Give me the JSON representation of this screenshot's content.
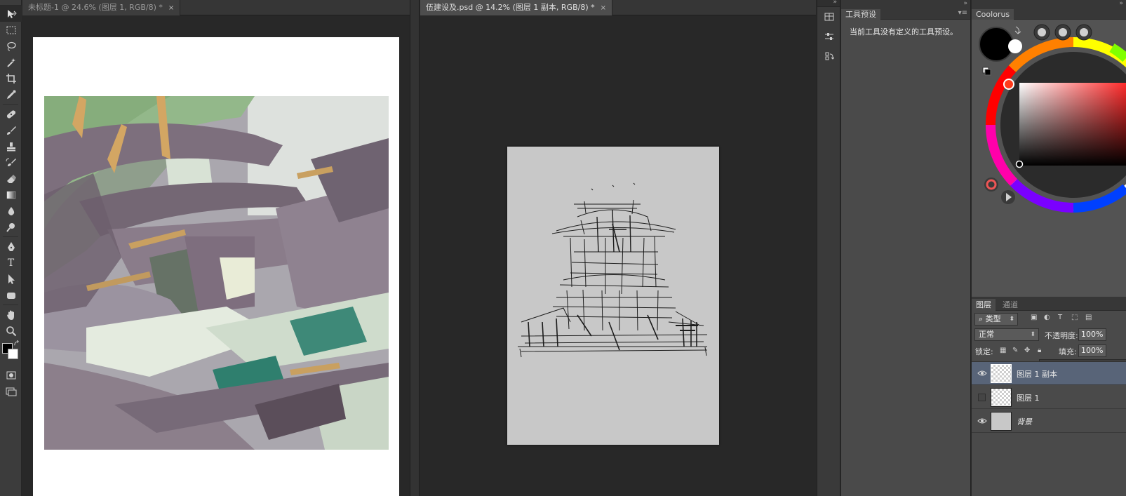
{
  "colors": {
    "chrome_dark": "#282828",
    "panel": "#4a4a4a",
    "selection": "#586478",
    "foreground": "#000000",
    "background": "#ffffff"
  },
  "tools": [
    {
      "name": "move-tool",
      "icon": "move-arrow-icon"
    },
    {
      "name": "marquee-tool",
      "icon": "rect-marquee-icon"
    },
    {
      "name": "lasso-tool",
      "icon": "lasso-icon"
    },
    {
      "name": "magic-wand-tool",
      "icon": "magic-wand-icon"
    },
    {
      "name": "crop-tool",
      "icon": "crop-icon"
    },
    {
      "name": "eyedropper-tool",
      "icon": "eyedropper-icon"
    },
    {
      "name": "healing-tool",
      "icon": "bandage-icon"
    },
    {
      "name": "brush-tool",
      "icon": "brush-icon"
    },
    {
      "name": "stamp-tool",
      "icon": "stamp-icon"
    },
    {
      "name": "history-brush-tool",
      "icon": "history-brush-icon"
    },
    {
      "name": "eraser-tool",
      "icon": "eraser-icon"
    },
    {
      "name": "gradient-tool",
      "icon": "gradient-icon"
    },
    {
      "name": "blur-tool",
      "icon": "blur-drop-icon"
    },
    {
      "name": "dodge-tool",
      "icon": "dodge-icon"
    },
    {
      "name": "pen-tool",
      "icon": "pen-icon"
    },
    {
      "name": "type-tool",
      "icon": "type-icon",
      "glyph": "T"
    },
    {
      "name": "path-select-tool",
      "icon": "path-select-icon"
    },
    {
      "name": "shape-tool",
      "icon": "rounded-rect-icon"
    },
    {
      "name": "hand-tool",
      "icon": "hand-icon"
    },
    {
      "name": "zoom-tool",
      "icon": "magnifier-icon"
    }
  ],
  "documents": [
    {
      "tab": "未标题-1 @ 24.6% (图层 1, RGB/8) *",
      "close": "×",
      "active": false
    },
    {
      "tab": "伍建设及.psd @ 14.2% (图层 1 副本, RGB/8) *",
      "close": "×",
      "active": true
    }
  ],
  "tool_presets": {
    "tab": "工具预设",
    "message": "当前工具没有定义的工具预设。",
    "menu": "▾≡"
  },
  "coolorus": {
    "tab": "Coolorus"
  },
  "layers": {
    "tabs": [
      "图层",
      "通道"
    ],
    "filter": "类型",
    "blend_mode": "正常",
    "opacity_label": "不透明度:",
    "opacity": "100%",
    "lock_label": "锁定:",
    "fill_label": "填充:",
    "fill": "100%",
    "items": [
      {
        "name": "图层 1 副本",
        "visible": true,
        "selected": true,
        "type": "transparent"
      },
      {
        "name": "图层 1",
        "visible": false,
        "selected": false,
        "type": "transparent"
      },
      {
        "name": "背景",
        "visible": true,
        "selected": false,
        "type": "solid",
        "italic": true
      }
    ]
  }
}
